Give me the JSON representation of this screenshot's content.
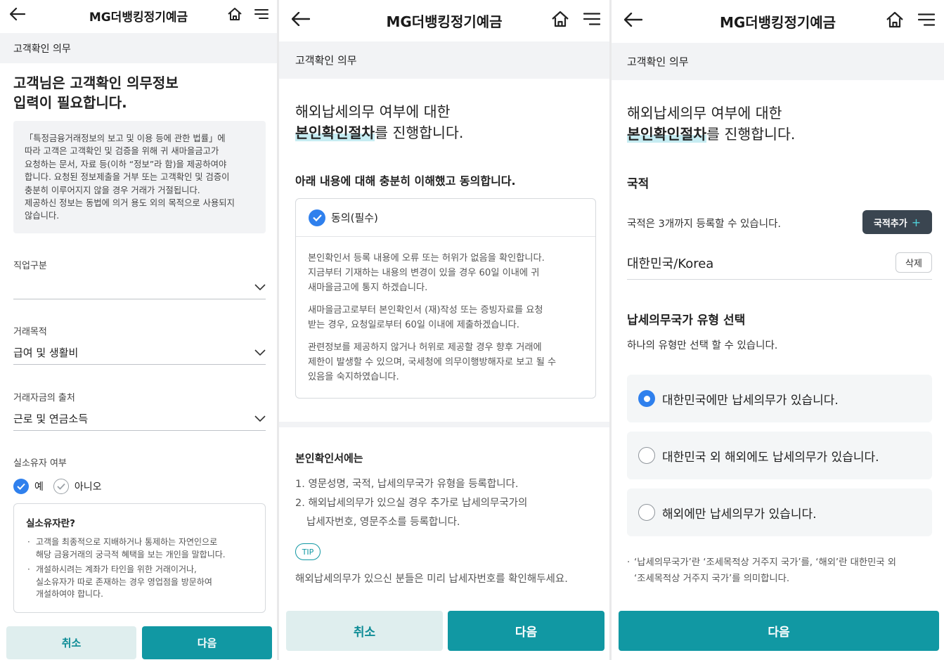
{
  "header": {
    "title": "MG더뱅킹정기예금"
  },
  "screen1": {
    "section": "고객확인 의무",
    "heading_line1": "고객님은 고객확인 의무정보",
    "heading_line2": "입력이 필요합니다.",
    "notice_lines": [
      "「특정금융거래정보의 보고 및 이용 등에 관한 법률」에",
      "따라 고객은 고객확인 및 검증을 위해 귀 새마을금고가",
      "요청하는 문서, 자료 등(이하 “정보”라 함)을 제공하여야",
      "합니다. 요청된 정보제출을 거부 또는 고객확인 및 검증이",
      "충분히 이루어지지 않을 경우 거래가 거절됩니다.",
      "제공하신 정보는 동법에 의거 용도 외의 목적으로 사용되지",
      "않습니다."
    ],
    "fields": [
      {
        "label": "직업구분",
        "value": ""
      },
      {
        "label": "거래목적",
        "value": "급여 및 생활비"
      },
      {
        "label": "거래자금의 출처",
        "value": "근로 및 연금소득"
      }
    ],
    "owner_label": "실소유자 여부",
    "owner_yes": "예",
    "owner_no": "아니오",
    "owner_info_title": "실소유자란?",
    "owner_info_items": [
      [
        "고객을 최종적으로 지배하거나 통제하는 자연인으로",
        "해당 금융거래의 궁극적 혜택을 보는 개인을 말합니다."
      ],
      [
        "개설하시려는 계좌가 타인을 위한 거래이거나,",
        "실소유자가 따로 존재하는 경우 영업점을 방문하여",
        "개설하여야 합니다."
      ]
    ],
    "cancel": "취소",
    "next": "다음"
  },
  "screen2": {
    "section": "고객확인 의무",
    "intro_line1": "해외납세의무 여부에 대한",
    "intro_highlight": "본인확인절차",
    "intro_rest": "를 진행합니다.",
    "agree_heading": "아래 내용에 대해 충분히 이해했고 동의합니다.",
    "agree_check": "동의(필수)",
    "agree_paragraphs": [
      [
        "본인확인서 등록 내용에 오류 또는 허위가 없음을 확인합니다.",
        "지금부터 기재하는 내용의 변경이 있을 경우 60일 이내에 귀",
        "새마을금고에 통지 하겠습니다."
      ],
      [
        "새마을금고로부터 본인확인서 (재)작성 또는 증빙자료를 요청",
        "받는 경우, 요청일로부터 60일 이내에 제출하겠습니다."
      ],
      [
        "관련정보를 제공하지 않거나 허위로 제공할 경우 향후 거래에",
        "제한이 발생할 수 있으며, 국세청에 의무이행방해자로 보고 될 수",
        "있음을 숙지하였습니다."
      ]
    ],
    "cert_title": "본인확인서에는",
    "cert_items": [
      [
        "1. 영문성명, 국적, 납세의무국가 유형을 등록합니다."
      ],
      [
        "2. 해외납세의무가 있으실 경우 추가로 납세의무국가의",
        "납세자번호, 영문주소를 등록합니다."
      ]
    ],
    "tip_badge": "TIP",
    "tip_text": "해외납세의무가 있으신 분들은 미리 납세자번호를 확인해두세요.",
    "cancel": "취소",
    "next": "다음"
  },
  "screen3": {
    "section": "고객확인 의무",
    "intro_line1": "해외납세의무 여부에 대한",
    "intro_highlight": "본인확인절차",
    "intro_rest": "를 진행합니다.",
    "nationality_title": "국적",
    "nationality_desc": "국적은 3개까지 등록할 수 있습니다.",
    "add_button": "국적추가",
    "nationality_value": "대한민국/Korea",
    "delete_button": "삭제",
    "tax_title": "납세의무국가 유형 선택",
    "tax_desc": "하나의 유형만 선택 할 수 있습니다.",
    "options": [
      {
        "label": "대한민국에만 납세의무가 있습니다.",
        "selected": true
      },
      {
        "label": "대한민국 외 해외에도 납세의무가 있습니다.",
        "selected": false
      },
      {
        "label": "해외에만 납세의무가 있습니다.",
        "selected": false
      }
    ],
    "footnote_line1": "‘납세의무국가’란 ‘조세목적상 거주지 국가’를, ‘해외’란 대한민국 외",
    "footnote_line2": "‘조세목적상 거주지 국가’를 의미합니다.",
    "next": "다음"
  },
  "icons": [
    "back-arrow-icon",
    "home-icon",
    "menu-icon",
    "chevron-down-icon",
    "check-icon",
    "plus-icon"
  ],
  "colors": {
    "accent": "#1198a3",
    "cancel_bg": "#dfeeee",
    "check_blue": "#2f80ed",
    "add_button": "#3a4550"
  }
}
